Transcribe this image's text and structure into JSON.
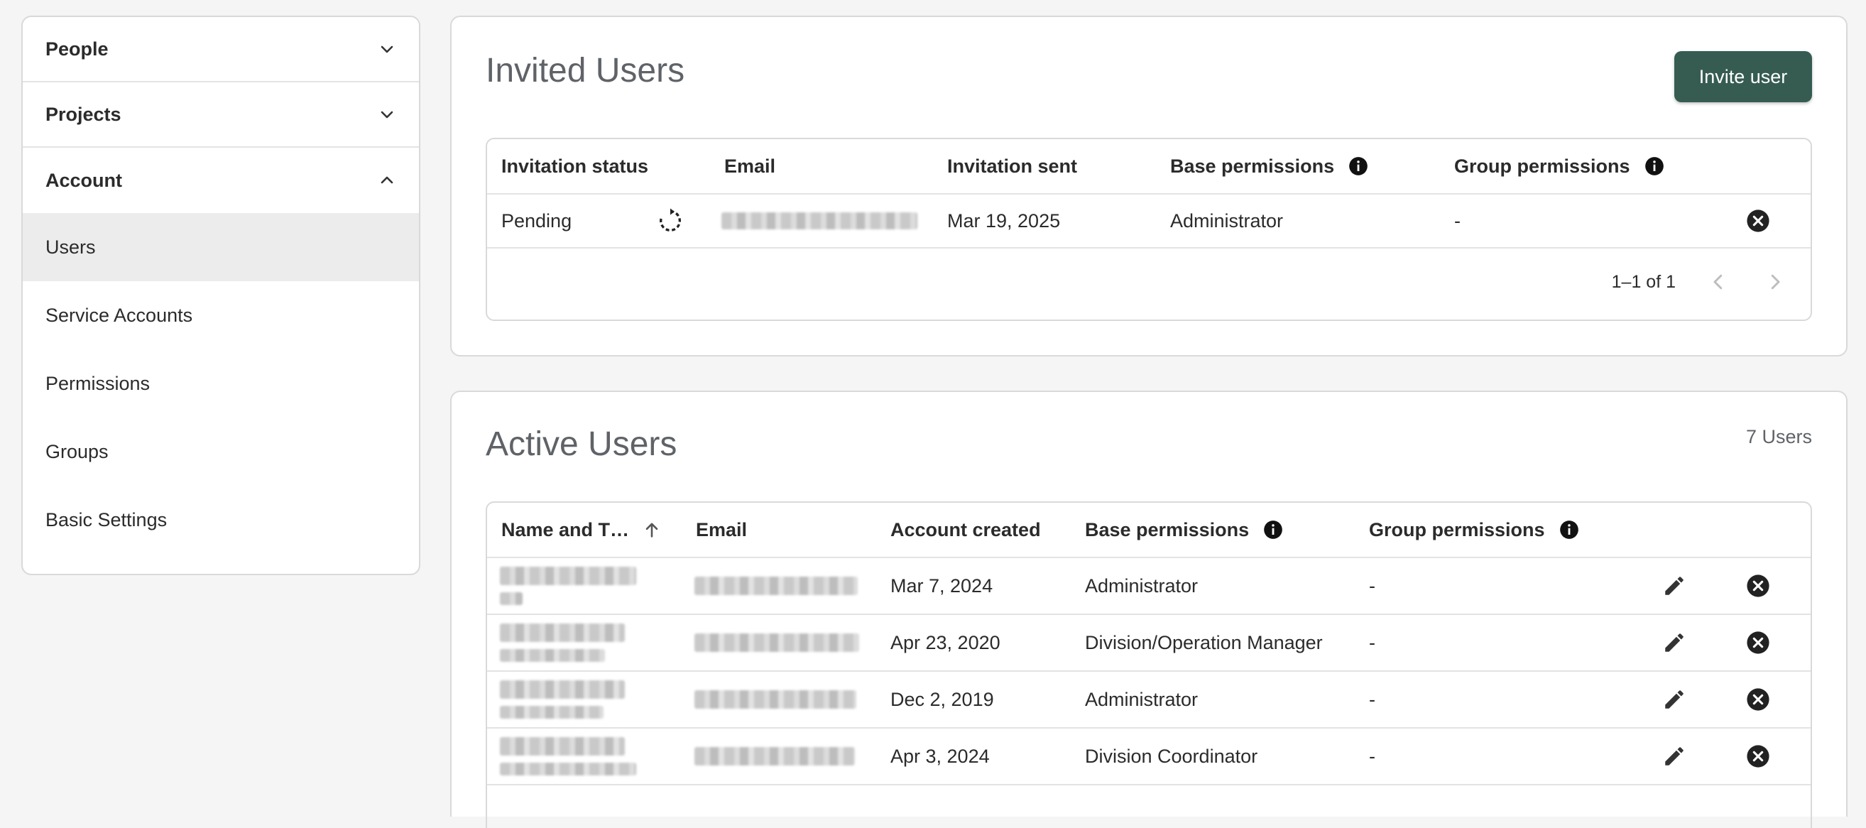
{
  "sidebar": {
    "sections": [
      {
        "label": "People",
        "expanded": false
      },
      {
        "label": "Projects",
        "expanded": false
      },
      {
        "label": "Account",
        "expanded": true
      }
    ],
    "items": [
      {
        "label": "Users",
        "active": true
      },
      {
        "label": "Service Accounts",
        "active": false
      },
      {
        "label": "Permissions",
        "active": false
      },
      {
        "label": "Groups",
        "active": false
      },
      {
        "label": "Basic Settings",
        "active": false
      }
    ]
  },
  "invited": {
    "title": "Invited Users",
    "invite_button": "Invite user",
    "columns": [
      "Invitation status",
      "Email",
      "Invitation sent",
      "Base permissions",
      "Group permissions"
    ],
    "rows": [
      {
        "status": "Pending",
        "sent": "Mar 19, 2025",
        "base": "Administrator",
        "group": "-"
      }
    ],
    "pagination": "1–1 of 1"
  },
  "active": {
    "title": "Active Users",
    "count": "7 Users",
    "columns": [
      "Name and T…",
      "Email",
      "Account created",
      "Base permissions",
      "Group permissions"
    ],
    "rows": [
      {
        "created": "Mar 7, 2024",
        "base": "Administrator",
        "group": "-"
      },
      {
        "created": "Apr 23, 2020",
        "base": "Division/Operation Manager",
        "group": "-"
      },
      {
        "created": "Dec 2, 2019",
        "base": "Administrator",
        "group": "-"
      },
      {
        "created": "Apr 3, 2024",
        "base": "Division Coordinator",
        "group": "-"
      }
    ]
  },
  "colors": {
    "primary_button": "#365c52",
    "title_gray": "#5f6368"
  }
}
